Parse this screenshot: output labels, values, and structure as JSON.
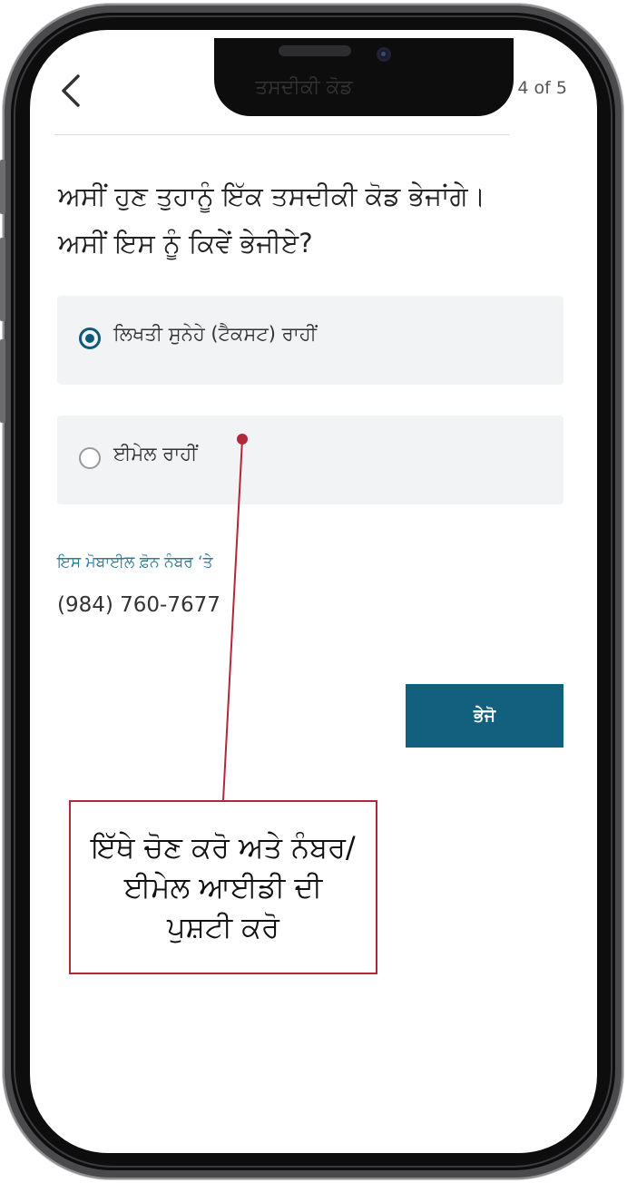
{
  "header": {
    "back_icon": "chevron-left-icon",
    "title": "ਤਸਦੀਕੀ ਕੋਡ",
    "step_counter": "4 of 5"
  },
  "question": {
    "line1": "ਅਸੀਂ ਹੁਣ ਤੁਹਾਨੂੰ ਇੱਕ ਤਸਦੀਕੀ ਕੋਡ ਭੇਜਾਂਗੇ।",
    "line2": "ਅਸੀਂ ਇਸ ਨੂੰ ਕਿਵੇਂ ਭੇਜੀਏ?"
  },
  "options": [
    {
      "label": "ਲਿਖਤੀ ਸੁਨੇਹੇ (ਟੈਕਸਟ) ਰਾਹੀਂ",
      "selected": true
    },
    {
      "label": "ਈਮੇਲ ਰਾਹੀਂ",
      "selected": false
    }
  ],
  "contact": {
    "label": "ਇਸ ਮੋਬਾਈਲ ਫ਼ੋਨ ਨੰਬਰ ‘ਤੇ",
    "value": "(984) 760-7677"
  },
  "send_button": {
    "label": "ਭੇਜੋ"
  },
  "annotation": {
    "text": "ਇੱਥੇ ਚੋਣ ਕਰੋ ਅਤੇ ਨੰਬਰ/ਈਮੇਲ ਆਈਡੀ ਦੀ ਪੁਸ਼ਟੀ ਕਰੋ"
  },
  "colors": {
    "accent": "#13607e",
    "annotation": "#b0283a",
    "option_bg": "#f2f3f5"
  }
}
